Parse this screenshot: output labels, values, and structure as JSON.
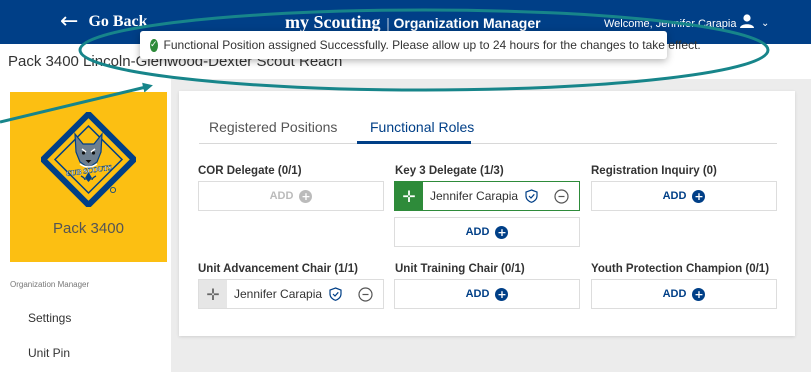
{
  "header": {
    "back_label": "Go Back",
    "brand": "my Scouting",
    "brand_sub": "Organization Manager",
    "welcome": "Welcome, Jennifer Carapia"
  },
  "page_title": "Pack 3400 Lincoln-Glenwood-Dexter Scout Reach",
  "toast": {
    "message": "Functional Position assigned Successfully. Please allow up to 24 hours for the changes to take effect."
  },
  "sidebar": {
    "pack_name": "Pack 3400",
    "emblem_text": "CUB SCOUTS",
    "section_label": "Organization Manager",
    "items": [
      {
        "label": "Settings"
      },
      {
        "label": "Unit Pin"
      }
    ]
  },
  "tabs": [
    {
      "label": "Registered Positions",
      "active": false
    },
    {
      "label": "Functional Roles",
      "active": true
    }
  ],
  "roles": {
    "cor_delegate": {
      "title": "COR Delegate (0/1)",
      "add_label": "ADD"
    },
    "key3_delegate": {
      "title": "Key 3 Delegate (1/3)",
      "member": "Jennifer Carapia",
      "add_label": "ADD"
    },
    "registration_inquiry": {
      "title": "Registration Inquiry (0)",
      "add_label": "ADD"
    },
    "unit_advancement_chair": {
      "title": "Unit Advancement Chair (1/1)",
      "member": "Jennifer Carapia"
    },
    "unit_training_chair": {
      "title": "Unit Training Chair (0/1)",
      "add_label": "ADD"
    },
    "youth_protection_champion": {
      "title": "Youth Protection Champion (0/1)",
      "add_label": "ADD"
    }
  },
  "colors": {
    "brand_blue": "#003f87",
    "cub_yellow": "#fcbf12",
    "success_green": "#2e8b3a",
    "annotation_teal": "#17858a"
  }
}
